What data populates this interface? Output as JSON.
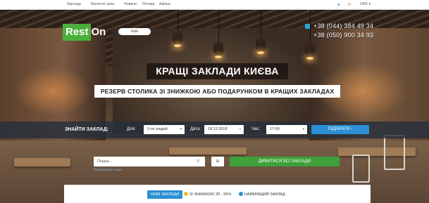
{
  "nav": {
    "links": [
      "Заклади",
      "Банкетні зали",
      "Новини",
      "Огляди",
      "Афіша"
    ],
    "lang": "UKR ▾"
  },
  "logo": {
    "part1": "Rest",
    "part2": "On"
  },
  "city": "Київ",
  "phones": [
    "+38 (044) 384 49 34",
    "+38 (050) 900 34 93"
  ],
  "hero": {
    "headline": "КРАЩІ ЗАКЛАДИ КИЄВА",
    "subheadline": "РЕЗЕРВ СТОЛИКА ЗІ ЗНИЖКОЮ АБО ПОДАРУНКОМ В КРАЩИХ ЗАКЛАДАХ"
  },
  "search": {
    "title": "ЗНАЙТИ ЗАКЛАД:",
    "for_label": "Для:",
    "guests": "2-ох людей",
    "date_label": "Дата:",
    "date": "18.12.2018",
    "time_label": "Час:",
    "time": "17:00",
    "find_button": "ПІДІБРАТИ"
  },
  "name_search": {
    "placeholder": "Пошук...",
    "mini_button": "Ш",
    "all_button": "ДИВИТИСЯ ВСІ ЗАКЛАДИ",
    "advanced_link": "Розширений пошук"
  },
  "tabs": [
    {
      "label": "НОВІ ЗАКЛАДИ",
      "active": true
    },
    {
      "label": "ЗІ ЗНИЖКОЮ 20 - 50%",
      "active": false
    },
    {
      "label": "НАЙКРАЩИЙ ЗАКЛАД",
      "active": false
    }
  ],
  "colors": {
    "brand_green": "#4caf3a",
    "accent_blue": "#2a8fd4",
    "cta_green": "#3ea13a"
  }
}
